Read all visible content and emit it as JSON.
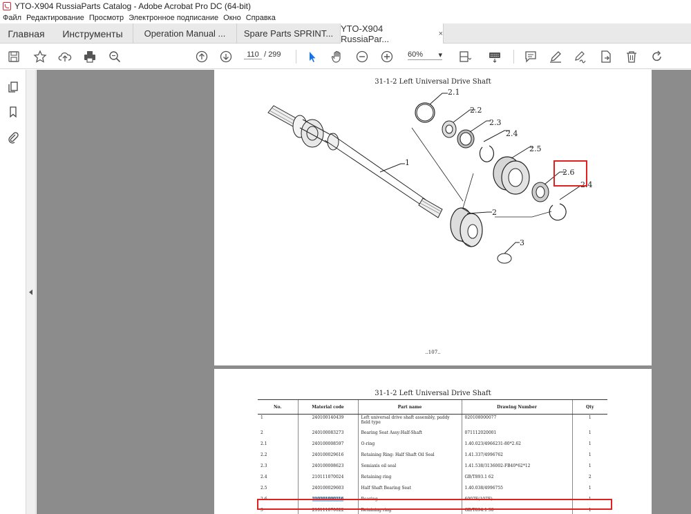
{
  "window": {
    "title": "YTO-X904 RussiaParts Catalog - Adobe Acrobat Pro DC (64-bit)"
  },
  "menu": [
    "Файл",
    "Редактирование",
    "Просмотр",
    "Электронное подписание",
    "Окно",
    "Справка"
  ],
  "tabs": {
    "home": "Главная",
    "tools": "Инструменты",
    "docs": [
      {
        "label": "Operation Manual ...",
        "active": false
      },
      {
        "label": "Spare Parts SPRINT...",
        "active": false
      },
      {
        "label": "YTO-X904 RussiaPar...",
        "active": true,
        "close": "×"
      }
    ]
  },
  "toolbar": {
    "page_current": "110",
    "page_sep": "/",
    "page_total": "299",
    "zoom": "60%",
    "icons": [
      "save-icon",
      "star-icon",
      "cloud-upload-icon",
      "print-icon",
      "search-zoom-icon",
      "page-up-icon",
      "page-down-icon",
      "select-arrow-icon",
      "hand-icon",
      "zoom-out-icon",
      "zoom-in-icon",
      "fit-page-icon",
      "keyboard-icon",
      "comment-icon",
      "highlight-pen-icon",
      "sign-icon",
      "share-icon",
      "delete-icon",
      "rotate-icon"
    ]
  },
  "page1": {
    "title": "31-1-2 Left Universal Drive Shaft",
    "callouts": [
      "2.1",
      "2.2",
      "2.3",
      "2.4",
      "2.5",
      "2.6",
      "2.4",
      "1",
      "2",
      "3"
    ],
    "page_number": "..107.."
  },
  "page2": {
    "title": "31-1-2 Left Universal Drive Shaft",
    "columns": [
      "No.",
      "Material code",
      "Part name",
      "Drawing Number",
      "Qty"
    ],
    "rows": [
      {
        "no": "1",
        "code": "240100140439",
        "name": "Left universal drive shaft assembly, paddy field type",
        "drawing": "020108000077",
        "qty": "1"
      },
      {
        "no": "2",
        "code": "240100083273",
        "name": "Bearing Seat Assy:Half-Shaft",
        "drawing": "071112020001",
        "qty": "1"
      },
      {
        "no": "2.1",
        "code": "240100008597",
        "name": "O-ring",
        "drawing": "1.40.023/4966231-80*2.62",
        "qty": "1"
      },
      {
        "no": "2.2",
        "code": "240100029616",
        "name": "Retaining Ring: Half Shaft Oil Seal",
        "drawing": "1.41.337/4996762",
        "qty": "1"
      },
      {
        "no": "2.3",
        "code": "240100008623",
        "name": "Semiaxis oil seal",
        "drawing": "1.41.538/3136002-FB40*62*12",
        "qty": "1"
      },
      {
        "no": "2.4",
        "code": "210111070024",
        "name": "Retaining ring",
        "drawing": "GB/T893.1 62",
        "qty": "2"
      },
      {
        "no": "2.5",
        "code": "240100029603",
        "name": "Half Shaft Bearing Seat",
        "drawing": "1.40.038/4996755",
        "qty": "1"
      },
      {
        "no": "2.6",
        "code": "210201000216",
        "name": "Bearing",
        "drawing": "6007E(107E)",
        "qty": "1"
      },
      {
        "no": "3",
        "code": "210111070022",
        "name": "Retaining ring",
        "drawing": "GB/T894.1 30",
        "qty": "1"
      }
    ]
  },
  "colors": {
    "highlight": "#e01f1f",
    "selection": "#9cc3e8",
    "doc_bg": "#8c8c8c"
  }
}
